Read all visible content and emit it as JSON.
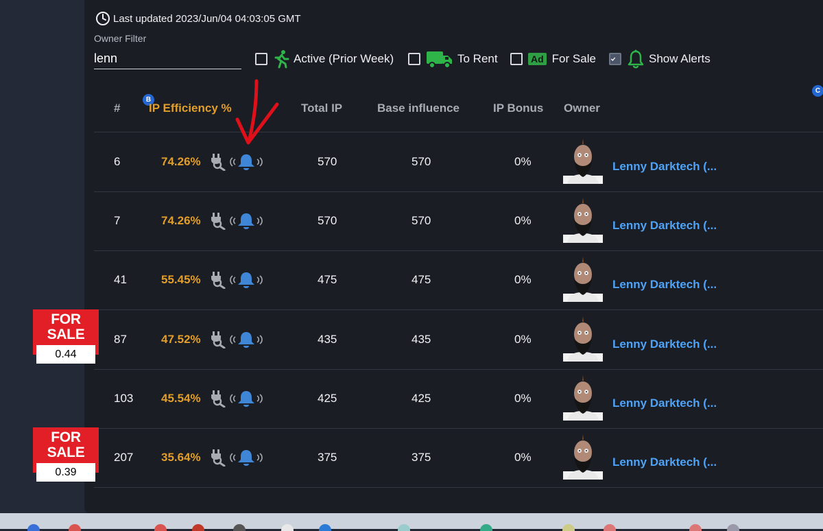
{
  "header": {
    "last_updated": "Last updated 2023/Jun/04 04:03:05 GMT"
  },
  "filter": {
    "label": "Owner Filter",
    "value": "lenn"
  },
  "options": {
    "active_label": "Active (Prior Week)",
    "rent_label": "To Rent",
    "sale_badge": "Ad",
    "sale_label": "For Sale",
    "alerts_label": "Show Alerts",
    "alerts_checked": true
  },
  "badges": {
    "b": "B",
    "c": "C"
  },
  "columns": {
    "num": "#",
    "efficiency": "IP Efficiency %",
    "total_ip": "Total IP",
    "base_influence": "Base influence",
    "ip_bonus": "IP Bonus",
    "owner": "Owner"
  },
  "rows": [
    {
      "num": "6",
      "efficiency": "74.26%",
      "total_ip": "570",
      "base_influence": "570",
      "ip_bonus": "0%",
      "owner": "Lenny Darktech (..."
    },
    {
      "num": "7",
      "efficiency": "74.26%",
      "total_ip": "570",
      "base_influence": "570",
      "ip_bonus": "0%",
      "owner": "Lenny Darktech (..."
    },
    {
      "num": "41",
      "efficiency": "55.45%",
      "total_ip": "475",
      "base_influence": "475",
      "ip_bonus": "0%",
      "owner": "Lenny Darktech (..."
    },
    {
      "num": "87",
      "efficiency": "47.52%",
      "total_ip": "435",
      "base_influence": "435",
      "ip_bonus": "0%",
      "owner": "Lenny Darktech (..."
    },
    {
      "num": "103",
      "efficiency": "45.54%",
      "total_ip": "425",
      "base_influence": "425",
      "ip_bonus": "0%",
      "owner": "Lenny Darktech (..."
    },
    {
      "num": "207",
      "efficiency": "35.64%",
      "total_ip": "375",
      "base_influence": "375",
      "ip_bonus": "0%",
      "owner": "Lenny Darktech (..."
    }
  ],
  "sale_tags": [
    {
      "title": "FOR SALE",
      "price": "0.44"
    },
    {
      "title": "FOR SALE",
      "price": "0.39"
    }
  ],
  "icons": {
    "clock": "clock-icon",
    "runner": "running-person-icon",
    "truck": "truck-icon",
    "bell": "bell-icon",
    "plug": "plug-search-icon",
    "alert_bell": "ringing-bell-icon",
    "arrow": "annotation-arrow"
  },
  "colors": {
    "accent_orange": "#e39e2a",
    "link_blue": "#4fa3f7",
    "alert_blue": "#3f86d6",
    "green": "#2fb44a",
    "sale_red": "#e21f26",
    "annotation_red": "#e0101a"
  }
}
